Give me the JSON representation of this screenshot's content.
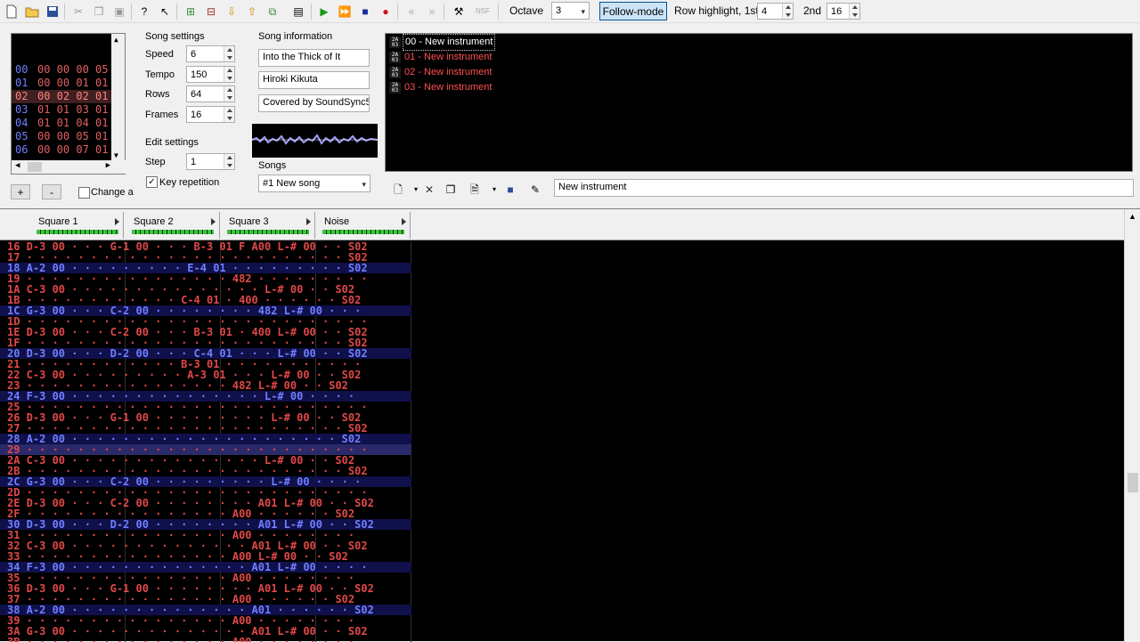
{
  "toolbar": {
    "octave_label": "Octave",
    "octave_value": "3",
    "follow_mode": "Follow-mode",
    "row_highlight_label": "Row highlight, 1st",
    "row_highlight_1st": "4",
    "second_label": "2nd",
    "row_highlight_2nd": "16"
  },
  "frames": {
    "rows": [
      {
        "num": "00",
        "cells": "00 00 00 05"
      },
      {
        "num": "01",
        "cells": "00 00 01 01"
      },
      {
        "num": "02",
        "cells": "00 02 02 01"
      },
      {
        "num": "03",
        "cells": "01 01 03 01"
      },
      {
        "num": "04",
        "cells": "01 01 04 01"
      },
      {
        "num": "05",
        "cells": "00 00 05 01"
      },
      {
        "num": "06",
        "cells": "00 00 07 01"
      }
    ],
    "add_label": "+",
    "remove_label": "-",
    "change_all_label": "Change a"
  },
  "song_settings": {
    "title": "Song settings",
    "speed_label": "Speed",
    "speed": "6",
    "tempo_label": "Tempo",
    "tempo": "150",
    "rows_label": "Rows",
    "rows": "64",
    "frames_label": "Frames",
    "frames": "16"
  },
  "edit_settings": {
    "title": "Edit settings",
    "step_label": "Step",
    "step": "1",
    "key_repetition": "Key repetition"
  },
  "song_info": {
    "title": "Song information",
    "name": "Into the Thick of It",
    "artist": "Hiroki Kikuta",
    "copyright": "Covered by SoundSync5",
    "songs_label": "Songs",
    "song_select": "#1 New song"
  },
  "instruments": {
    "items": [
      {
        "icon": "2A03",
        "label": "00 - New instrument"
      },
      {
        "icon": "2A03",
        "label": "01 - New instrument"
      },
      {
        "icon": "2A03",
        "label": "02 - New instrument"
      },
      {
        "icon": "2A03",
        "label": "03 - New instrument"
      }
    ],
    "name_field": "New instrument"
  },
  "channels": [
    {
      "name": "Square 1"
    },
    {
      "name": "Square 2"
    },
    {
      "name": "Square 3"
    },
    {
      "name": "Noise"
    }
  ],
  "pattern_rows": [
    "16 D-3 00 · · · G-1 00 · · · B-3 01 F A00 L-# 00 · · S02",
    "17 · · · · · · · · · · · · · · · · · · · · · · · · · S02",
    "18 A-2 00 · · · · · · · · · E-4 01 · · · · · · · · · S02",
    "19 · · · · · · · · · · · · · · · · 482 · · · · · · · · ·",
    "1A C-3 00 · · · · · · · · · · · · · · · L-# 00 · · S02",
    "1B · · · · · · · · · · · · C-4 01 · 400 · · · · · · S02",
    "1C G-3 00 · · · C-2 00 · · · · · · · · 482 L-# 00 · · ·",
    "1D · · · · · · · · · · · · · · · · · · · · · · · · · · ·",
    "1E D-3 00 · · · C-2 00 · · · B-3 01 · 400 L-# 00 · · S02",
    "1F · · · · · · · · · · · · · · · · · · · · · · · · · S02",
    "20 D-3 00 · · · D-2 00 · · · C-4 01 · · · L-# 00 · · S02",
    "21 · · · · · · · · · · · · B-3 01 · · · · · · · · · · ·",
    "22 C-3 00 · · · · · · · · · A-3 01 · · · L-# 00 · · S02",
    "23 · · · · · · · · · · · · · · · · 482 L-# 00 · · S02",
    "24 F-3 00 · · · · · · · · · · · · · · · L-# 00 · · · ·",
    "25 · · · · · · · · · · · · · · · · · · · · · · · · · · ·",
    "26 D-3 00 · · · G-1 00 · · · · · · · · · L-# 00 · · S02",
    "27 · · · · · · · · · · · · · · · · · · · · · · · · · S02",
    "28 A-2 00 · · · · · · · · · · · · · · · · · · · · · S02",
    "29 · · · · · · · · · · · · · · · · · · · · · · · · · · ·",
    "2A C-3 00 · · · · · · · · · · · · · · · L-# 00 · · S02",
    "2B · · · · · · · · · · · · · · · · · · · · · · · · · S02",
    "2C G-3 00 · · · C-2 00 · · · · · · · · · L-# 00 · · · ·",
    "2D · · · · · · · · · · · · · · · · · · · · · · · · · · ·",
    "2E D-3 00 · · · C-2 00 · · · · · · · · A01 L-# 00 · · S02",
    "2F · · · · · · · · · · · · · · · · A00 · · · · · · S02",
    "30 D-3 00 · · · D-2 00 · · · · · · · · A01 L-# 00 · · S02",
    "31 · · · · · · · · · · · · · · · · A00 · · · · · · · ·",
    "32 C-3 00 · · · · · · · · · · · · · · A01 L-# 00 · · S02",
    "33 · · · · · · · · · · · · · · · · A00 L-# 00 · · S02",
    "34 F-3 00 · · · · · · · · · · · · · · A01 L-# 00 · · · ·",
    "35 · · · · · · · · · · · · · · · · A00 · · · · · · · ·",
    "36 D-3 00 · · · G-1 00 · · · · · · · · A01 L-# 00 · · S02",
    "37 · · · · · · · · · · · · · · · · A00 · · · · · · S02",
    "38 A-2 00 · · · · · · · · · · · · · · A01 · · · · · · S02",
    "39 · · · · · · · · · · · · · · · · A00 · · · · · · · ·",
    "3A G-3 00 · · · · · · · · · · · · · · A01 L-# 00 · · S02",
    "3B · · · · · · · · · · · · · · · · A00 · · · · · · · ·"
  ]
}
